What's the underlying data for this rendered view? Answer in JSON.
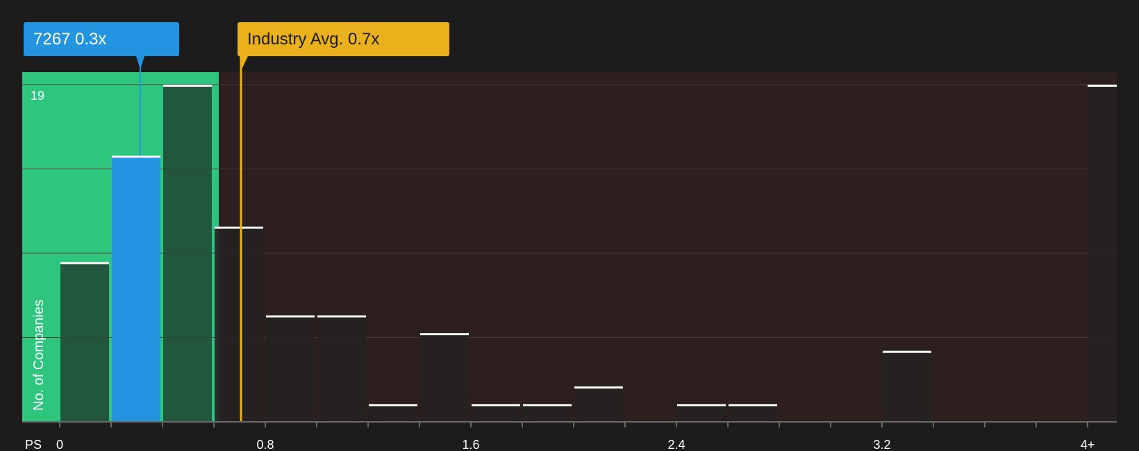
{
  "chart_data": {
    "type": "bar",
    "title": "",
    "xlabel": "PS",
    "ylabel": "No. of Companies",
    "y_max_label": "19",
    "ylim": [
      0,
      19
    ],
    "x_range": [
      0,
      4
    ],
    "x_ticks": [
      "0",
      "0.8",
      "1.6",
      "2.4",
      "3.2",
      "4+"
    ],
    "bin_width": 0.2,
    "bins": [
      {
        "start": 0.0,
        "count": 9
      },
      {
        "start": 0.2,
        "count": 15
      },
      {
        "start": 0.4,
        "count": 19
      },
      {
        "start": 0.6,
        "count": 11
      },
      {
        "start": 0.8,
        "count": 6
      },
      {
        "start": 1.0,
        "count": 6
      },
      {
        "start": 1.2,
        "count": 1
      },
      {
        "start": 1.4,
        "count": 5
      },
      {
        "start": 1.6,
        "count": 1
      },
      {
        "start": 1.8,
        "count": 1
      },
      {
        "start": 2.0,
        "count": 2
      },
      {
        "start": 2.2,
        "count": 0
      },
      {
        "start": 2.4,
        "count": 1
      },
      {
        "start": 2.6,
        "count": 1
      },
      {
        "start": 2.8,
        "count": 0
      },
      {
        "start": 3.0,
        "count": 0
      },
      {
        "start": 3.2,
        "count": 4
      },
      {
        "start": 3.4,
        "count": 0
      },
      {
        "start": 3.6,
        "count": 0
      },
      {
        "start": 3.8,
        "count": 0
      },
      {
        "start": 4.0,
        "count": 19,
        "overflow": true
      }
    ],
    "company": {
      "ticker": "7267",
      "value": 0.3,
      "label": "7267 0.3x"
    },
    "industry_avg": {
      "value": 0.7,
      "label": "Industry Avg. 0.7x"
    },
    "fair_region_end": 0.7
  },
  "colors": {
    "background": "#1c1c1c",
    "good_region": "#2ec57f",
    "bad_region": "#2e1f1f",
    "company_bar": "#2394e0",
    "industry_line": "#eab11c",
    "bar_dark": "#224d37",
    "bar_neutral": "#262222",
    "cap_line": "#ffffff",
    "grid": "#4a3a3a",
    "axis_text": "#ffffff"
  }
}
